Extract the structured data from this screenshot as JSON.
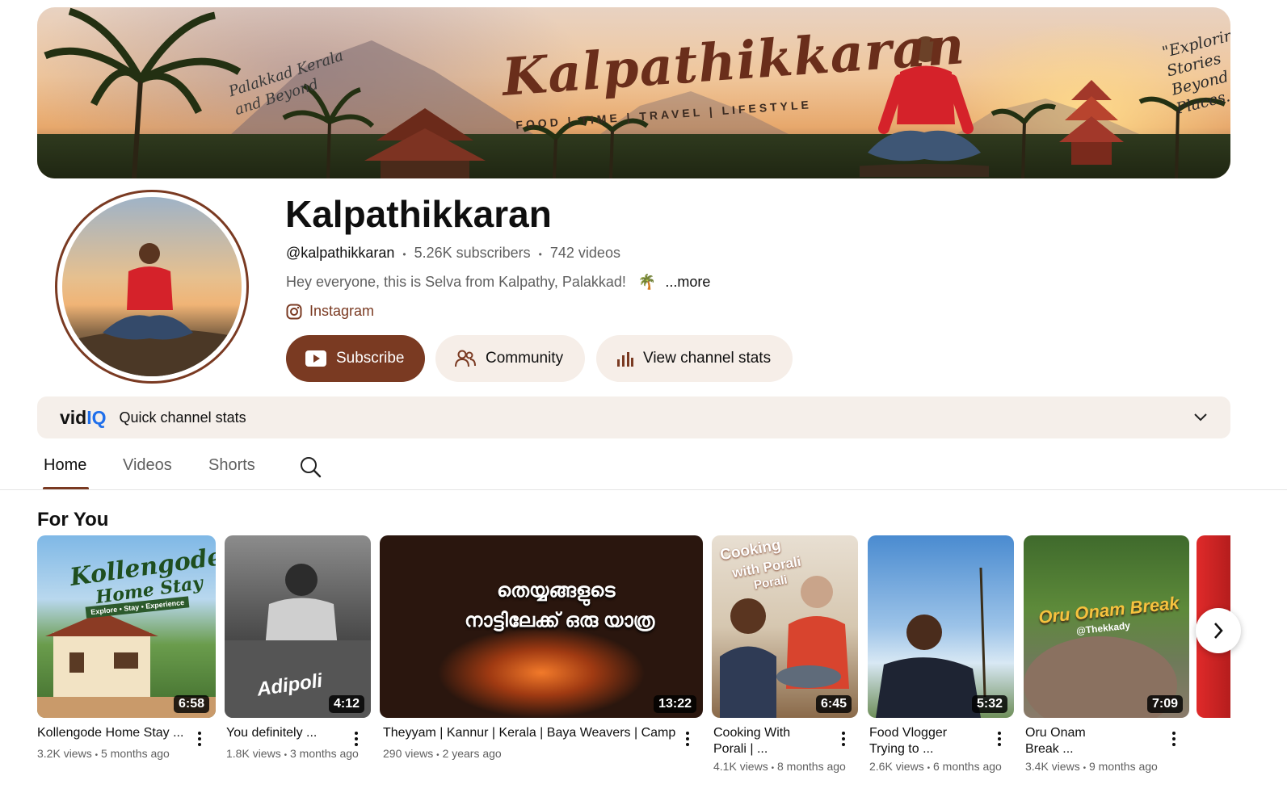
{
  "banner": {
    "title": "Kalpathikkaran",
    "tags": "FOOD | TIME | TRAVEL | LIFESTYLE",
    "left_note": "Palakkad Kerala and Beyond",
    "right_note": "\"Exploring Stories Beyond Places....!"
  },
  "channel": {
    "name": "Kalpathikkaran",
    "handle": "@kalpathikkaran",
    "subscribers": "5.26K subscribers",
    "videos": "742 videos",
    "separator": "•",
    "description": "Hey everyone, this is Selva from Kalpathy, Palakkad!",
    "description_emoji": "🌴",
    "more": "...more",
    "link_label": "Instagram"
  },
  "buttons": {
    "subscribe": "Subscribe",
    "community": "Community",
    "stats": "View channel stats"
  },
  "vidiq": {
    "logo_a": "vid",
    "logo_b": "IQ",
    "label": "Quick channel stats"
  },
  "tabs": [
    "Home",
    "Videos",
    "Shorts"
  ],
  "section_title": "For You",
  "videos": [
    {
      "title": "Kollengode Home Stay ...",
      "views": "3.2K views",
      "age": "5 months ago",
      "duration": "6:58",
      "thumb_text": "Kollengode",
      "thumb_text2": "Home Stay",
      "thumb_text3": "Explore • Stay • Experience"
    },
    {
      "title": "You definitely ...",
      "views": "1.8K views",
      "age": "3 months ago",
      "duration": "4:12",
      "thumb_text": "Adipoli"
    },
    {
      "title": "Theyyam | Kannur | Kerala | Baya Weavers | Camp",
      "views": "290 views",
      "age": "2 years ago",
      "duration": "13:22",
      "thumb_text": "തെയ്യങ്ങളുടെ",
      "thumb_text2": "നാട്ടിലേക്ക് ഒരു യാത്ര"
    },
    {
      "title_line1": "Cooking With",
      "title_line2": "Porali | ...",
      "views": "4.1K views",
      "age": "8 months ago",
      "duration": "6:45",
      "thumb_text": "Cooking",
      "thumb_text2": "with Porali",
      "thumb_text3": "Porali"
    },
    {
      "title_line1": "Food Vlogger",
      "title_line2": "Trying to ...",
      "views": "2.6K views",
      "age": "6 months ago",
      "duration": "5:32"
    },
    {
      "title_line1": "Oru Onam",
      "title_line2": "Break ...",
      "views": "3.4K views",
      "age": "9 months ago",
      "duration": "7:09",
      "thumb_text": "Oru Onam Break",
      "thumb_text2": "@Thekkady"
    }
  ],
  "colors": {
    "brand": "#7a3a22",
    "pill_bg": "#f6eee8",
    "vidiq_blue": "#1f6feb"
  },
  "icons": {
    "subscribe": "youtube-play-icon",
    "community": "people-icon",
    "stats": "bar-chart-icon",
    "link": "instagram-icon",
    "search": "search-icon",
    "chevron": "chevron-down-icon",
    "next": "chevron-right-icon"
  }
}
